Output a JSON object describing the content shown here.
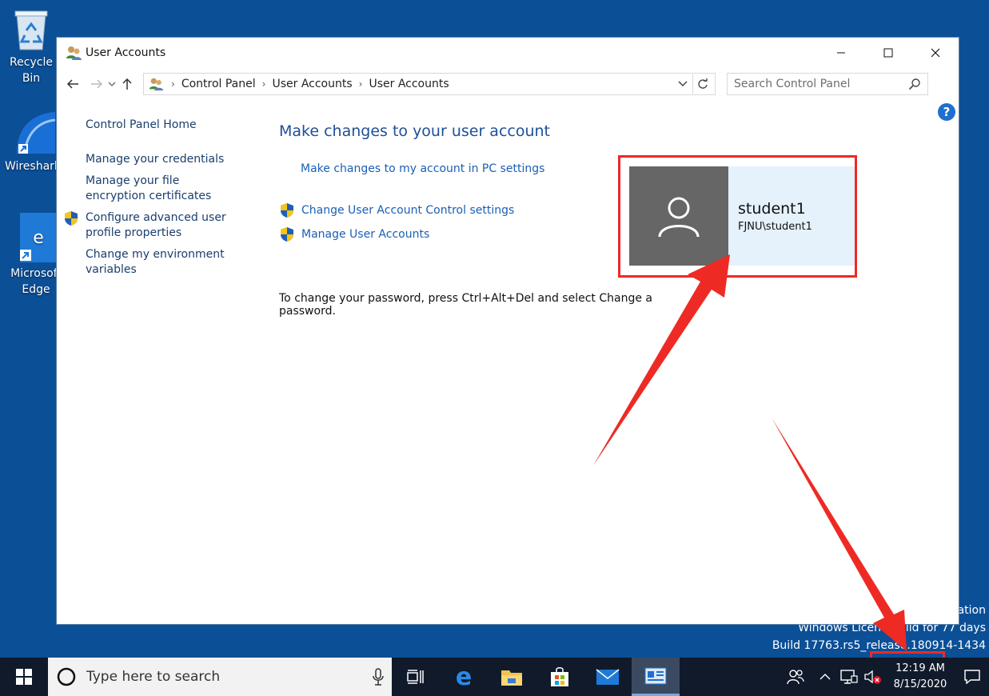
{
  "desktop": {
    "icons": [
      {
        "label": "Recycle Bin",
        "name": "recycle-bin"
      },
      {
        "label": "Wireshark",
        "name": "wireshark"
      },
      {
        "label": "Microsoft Edge",
        "name": "microsoft-edge"
      }
    ],
    "watermark": {
      "line1": "ation",
      "line2": "Windows Licen     alid for 77 days",
      "line3": "Build 17763.rs5_release.180914-1434"
    }
  },
  "window": {
    "title": "User Accounts",
    "breadcrumb": [
      "Control Panel",
      "User Accounts",
      "User Accounts"
    ],
    "search_placeholder": "Search Control Panel",
    "left_nav": {
      "home": "Control Panel Home",
      "items": [
        "Manage your credentials",
        "Manage your file encryption certificates",
        "Configure advanced user profile properties",
        "Change my environment variables"
      ]
    },
    "main": {
      "heading": "Make changes to your user account",
      "pc_settings_link": "Make changes to my account in PC settings",
      "uac_link": "Change User Account Control settings",
      "manage_link": "Manage User Accounts",
      "password_note": "To change your password, press Ctrl+Alt+Del and select Change a password."
    },
    "account": {
      "username": "student1",
      "domain_user": "FJNU\\student1"
    }
  },
  "taskbar": {
    "search_placeholder": "Type here to search",
    "time": "12:19 AM",
    "date": "8/15/2020"
  },
  "colors": {
    "desktop": "#0b4f97",
    "link": "#1a5fb4",
    "annotation": "#ee2a24",
    "taskbar": "#101a2a"
  }
}
